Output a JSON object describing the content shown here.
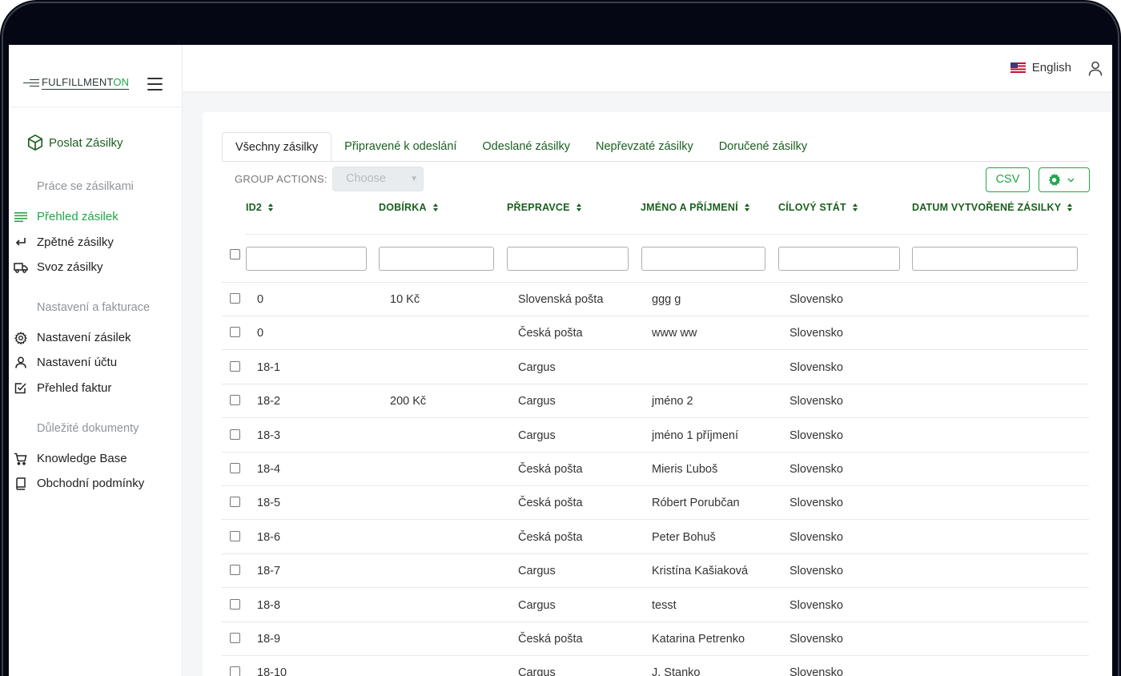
{
  "brand": {
    "logo_main": "FULFILLMENT",
    "logo_accent": "ON"
  },
  "sidebar": {
    "send_label": "Poslat Zásilky",
    "sections": [
      {
        "title": "Práce se zásilkami",
        "items": [
          {
            "label": "Přehled zásilek",
            "icon": "list-icon",
            "active": true
          },
          {
            "label": "Zpětné zásilky",
            "icon": "return-arrow-icon"
          },
          {
            "label": "Svoz zásilky",
            "icon": "truck-icon"
          }
        ]
      },
      {
        "title": "Nastavení a fakturace",
        "items": [
          {
            "label": "Nastavení zásilek",
            "icon": "gear-icon"
          },
          {
            "label": "Nastavení účtu",
            "icon": "user-icon"
          },
          {
            "label": "Přehled faktur",
            "icon": "checkbox-icon"
          }
        ]
      },
      {
        "title": "Důležité dokumenty",
        "items": [
          {
            "label": "Knowledge Base",
            "icon": "cart-icon"
          },
          {
            "label": "Obchodní podmínky",
            "icon": "book-icon"
          }
        ]
      }
    ]
  },
  "topbar": {
    "language": "English"
  },
  "tabs": [
    {
      "label": "Všechny zásilky",
      "active": true
    },
    {
      "label": "Připravené k odeslání"
    },
    {
      "label": "Odeslané zásilky"
    },
    {
      "label": "Nepřevzaté zásilky"
    },
    {
      "label": "Doručené zásilky"
    }
  ],
  "toolbar": {
    "group_actions_label": "GROUP ACTIONS:",
    "group_actions_placeholder": "Choose",
    "csv_label": "CSV"
  },
  "columns": [
    "ID2",
    "DOBÍRKA",
    "PŘEPRAVCE",
    "JMÉNO A PŘÍJMENÍ",
    "CÍLOVÝ STÁT",
    "DATUM VYTVOŘENÉ ZÁSILKY"
  ],
  "rows": [
    [
      "0",
      "10 Kč",
      "Slovenská pošta",
      "ggg g",
      "Slovensko",
      ""
    ],
    [
      "0",
      "",
      "Česká pošta",
      "www ww",
      "Slovensko",
      ""
    ],
    [
      "18-1",
      "",
      "Cargus",
      "",
      "Slovensko",
      ""
    ],
    [
      "18-2",
      "200 Kč",
      "Cargus",
      "jméno 2",
      "Slovensko",
      ""
    ],
    [
      "18-3",
      "",
      "Cargus",
      "jméno 1 příjmení",
      "Slovensko",
      ""
    ],
    [
      "18-4",
      "",
      "Česká pošta",
      "Mieris Ľuboš",
      "Slovensko",
      ""
    ],
    [
      "18-5",
      "",
      "Česká pošta",
      "Róbert Porubčan",
      "Slovensko",
      ""
    ],
    [
      "18-6",
      "",
      "Česká pošta",
      "Peter Bohuš",
      "Slovensko",
      ""
    ],
    [
      "18-7",
      "",
      "Cargus",
      "Kristína Kašiaková",
      "Slovensko",
      ""
    ],
    [
      "18-8",
      "",
      "Cargus",
      "tesst",
      "Slovensko",
      ""
    ],
    [
      "18-9",
      "",
      "Česká pošta",
      "Katarina Petrenko",
      "Slovensko",
      ""
    ],
    [
      "18-10",
      "",
      "Cargus",
      "J. Stanko",
      "Slovensko",
      ""
    ]
  ],
  "colors": {
    "accent": "#22a648",
    "accent_dark": "#1b5e20"
  }
}
